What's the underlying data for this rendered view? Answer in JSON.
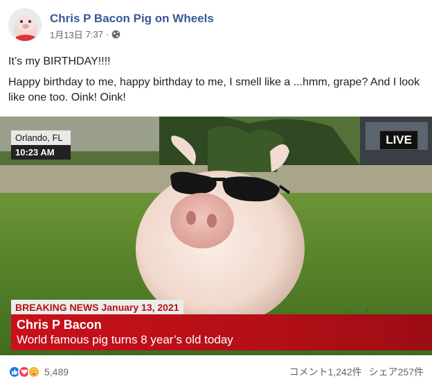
{
  "post": {
    "page_name": "Chris P Bacon Pig on Wheels",
    "date": "1月13日",
    "time": "7:37",
    "separator": "·",
    "icons": {
      "privacy": "globe-icon",
      "avatar": "pig-avatar"
    },
    "text_lines": [
      "It’s my BIRTHDAY!!!!",
      "Happy birthday to me, happy birthday to me, I smell like a ...hmm, grape? And I look like one too. Oink! Oink!"
    ]
  },
  "media": {
    "location": "Orlando, FL",
    "clock": "10:23 AM",
    "live_label": "LIVE",
    "breaking": "BREAKING NEWS January 13, 2021",
    "headline_name": "Chris P Bacon",
    "headline_tagline": "World famous pig turns 8 year’s old today",
    "colors": {
      "banner_red": "#c8111b",
      "breaking_text": "#b31010"
    }
  },
  "footer": {
    "reaction_icons": [
      "like-icon",
      "love-icon",
      "care-icon"
    ],
    "reaction_count": "5,489",
    "comments": "コメント1,242件",
    "shares": "シェア257件"
  },
  "colors": {
    "link": "#385898",
    "meta": "#606770",
    "text": "#1c1e21"
  }
}
